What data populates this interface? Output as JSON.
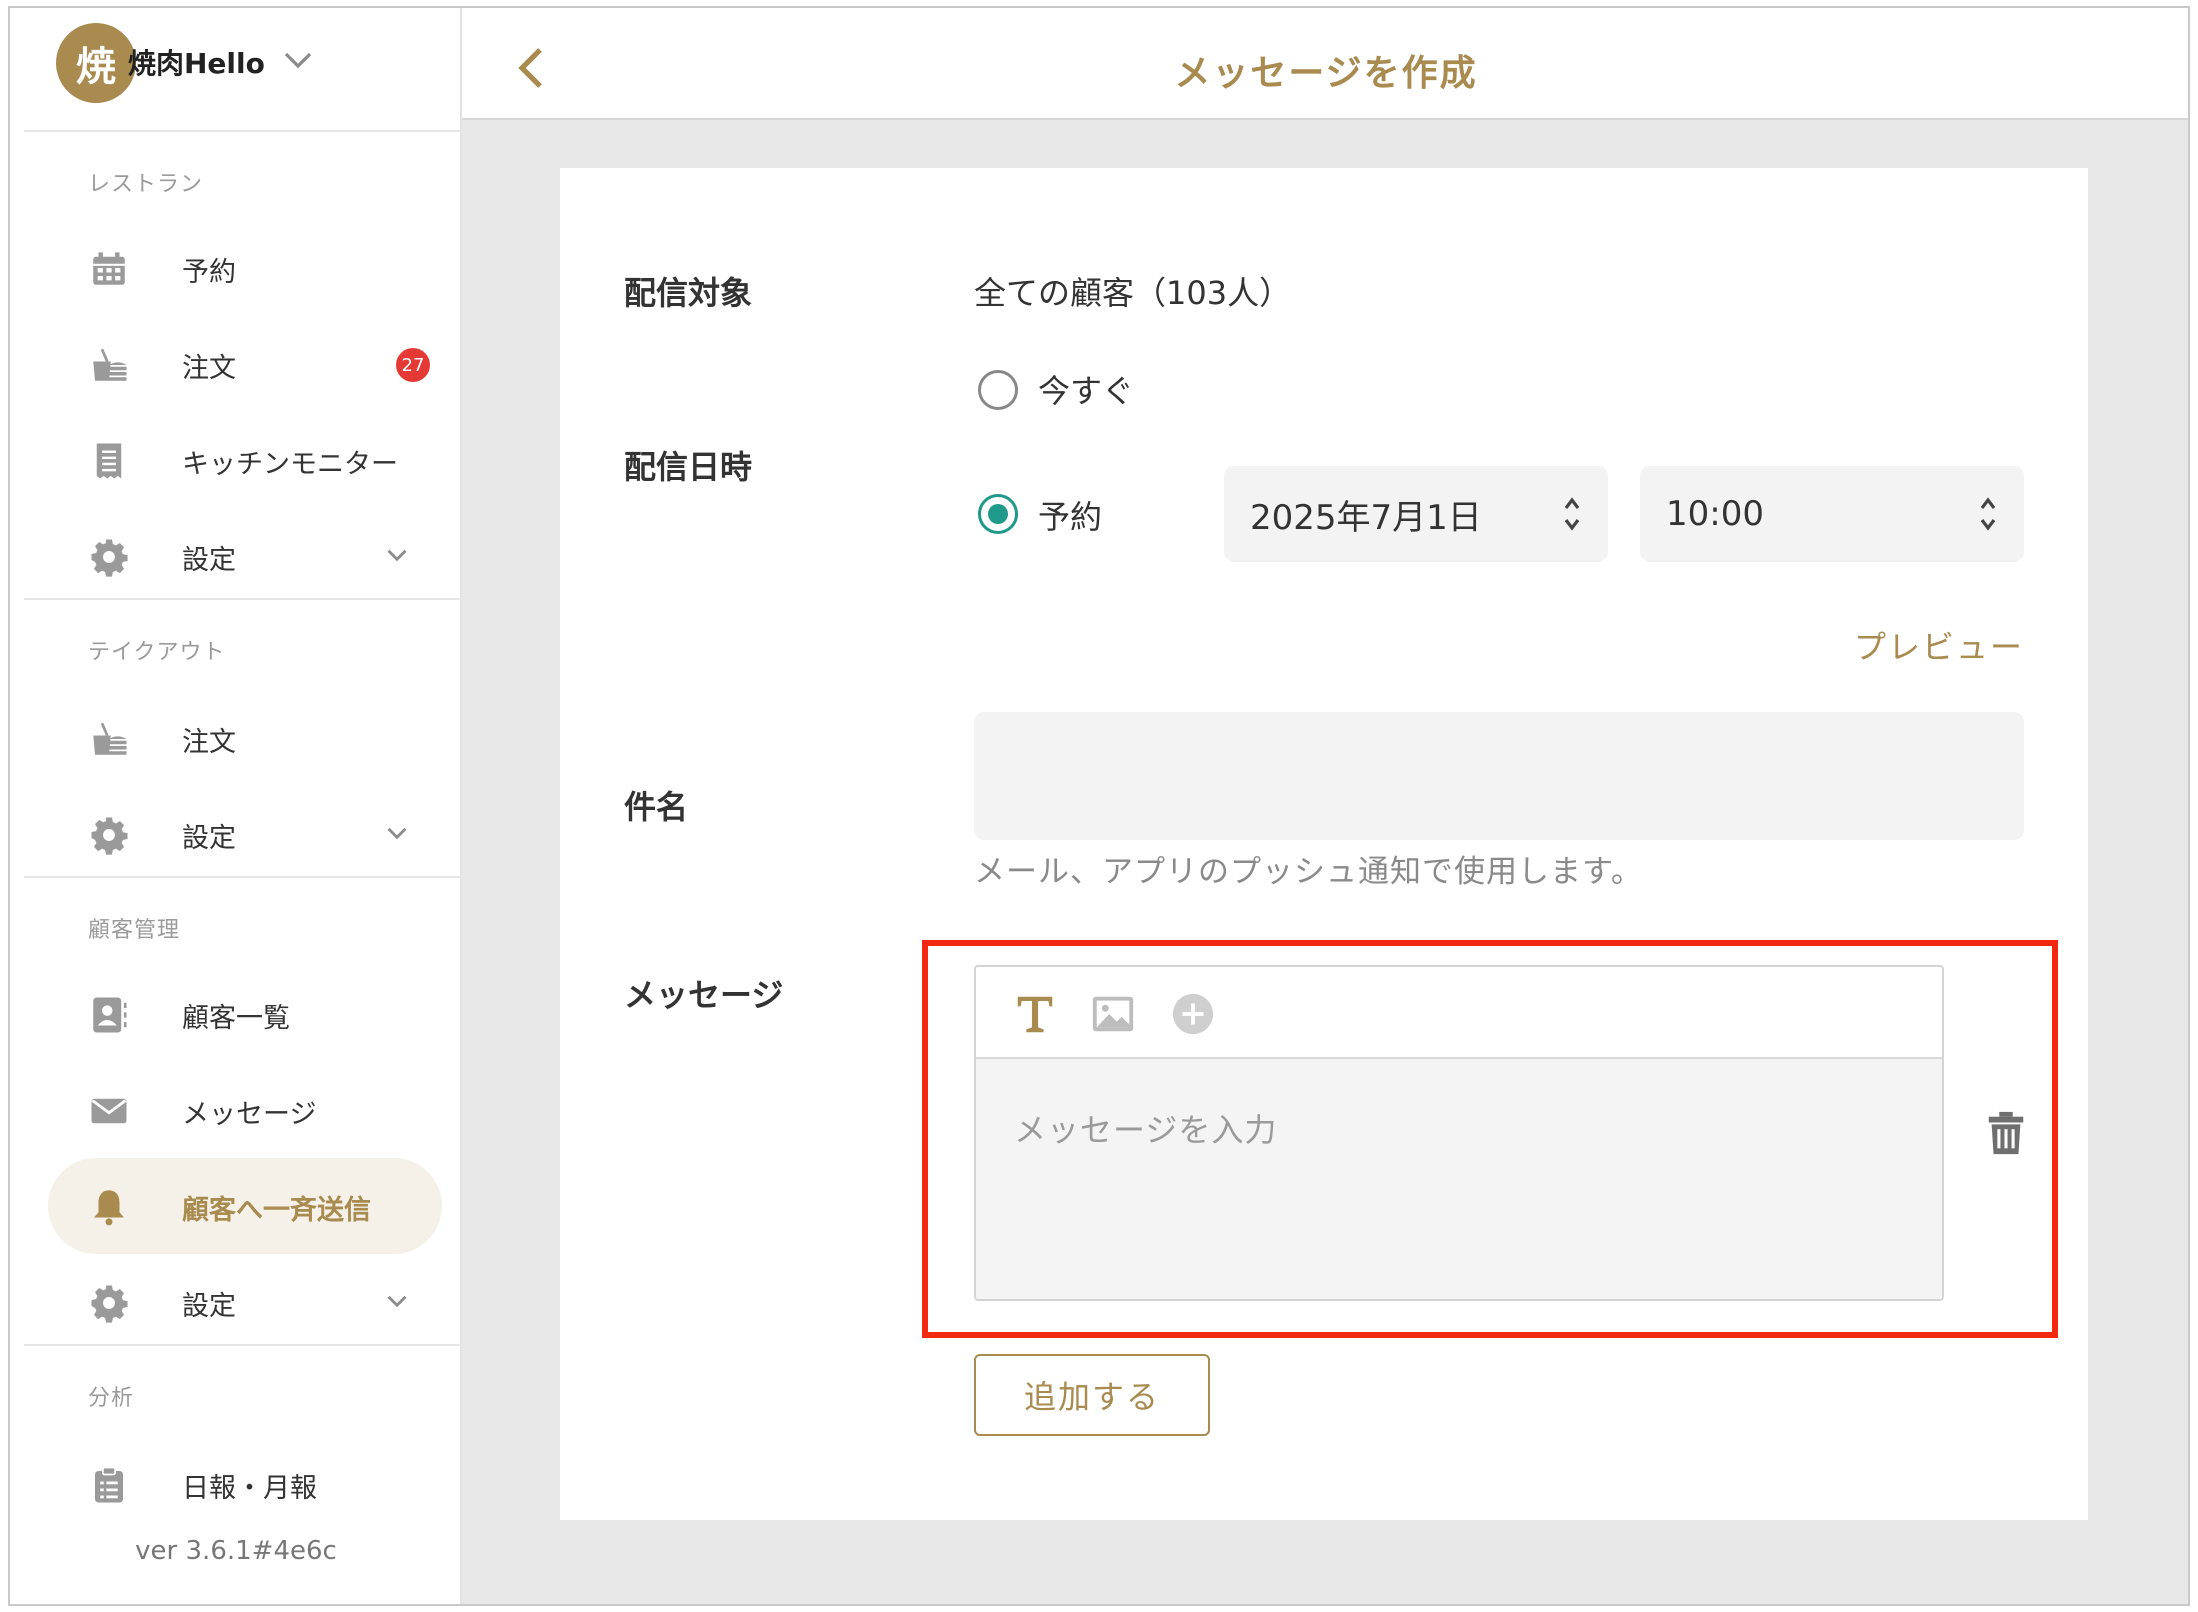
{
  "shop": {
    "avatar_char": "焼",
    "name": "焼肉Hello"
  },
  "sidebar": {
    "sections": [
      {
        "label": "レストラン"
      },
      {
        "label": "テイクアウト"
      },
      {
        "label": "顧客管理"
      },
      {
        "label": "分析"
      }
    ],
    "items": {
      "reservation": "予約",
      "order": "注文",
      "order_badge": "27",
      "kitchen_monitor": "キッチンモニター",
      "settings_restaurant": "設定",
      "takeout_order": "注文",
      "settings_takeout": "設定",
      "customer_list": "顧客一覧",
      "messages": "メッセージ",
      "broadcast": "顧客へ一斉送信",
      "settings_customer": "設定",
      "reports": "日報・月報"
    },
    "version": "ver 3.6.1#4e6c"
  },
  "header": {
    "title": "メッセージを作成"
  },
  "form": {
    "target_label": "配信対象",
    "target_value": "全ての顧客（103人）",
    "datetime_label": "配信日時",
    "option_now": "今すぐ",
    "option_scheduled": "予約",
    "selected_option": "scheduled",
    "date_value": "2025年7月1日",
    "time_value": "10:00",
    "preview_link": "プレビュー",
    "subject_label": "件名",
    "subject_value": "",
    "subject_hint": "メール、アプリのプッシュ通知で使用します。",
    "message_label": "メッセージ",
    "message_placeholder": "メッセージを入力",
    "add_button": "追加する"
  },
  "colors": {
    "accent": "#a98a4f",
    "radio": "#1f9a8a",
    "badge": "#e53935",
    "highlight": "#f2280f"
  }
}
